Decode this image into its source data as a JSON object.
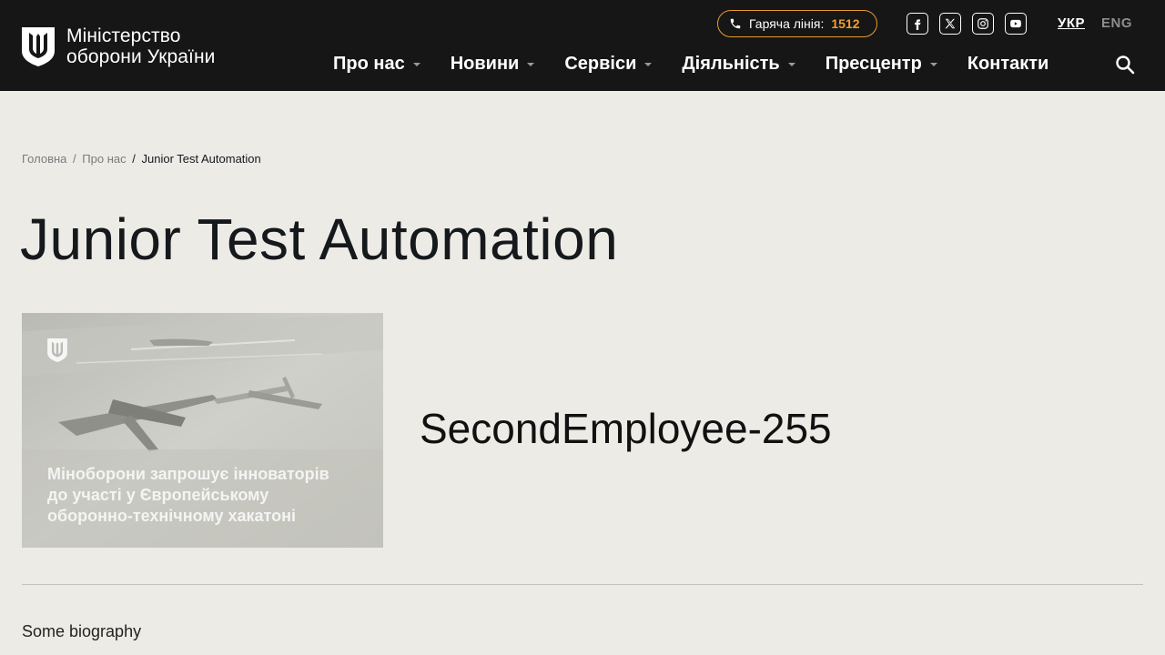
{
  "header": {
    "logo_line1": "Міністерство",
    "logo_line2": "оборони України",
    "hotline_label": "Гаряча лінія:",
    "hotline_number": "1512",
    "socials": [
      "facebook-icon",
      "x-twitter-icon",
      "instagram-icon",
      "youtube-icon"
    ],
    "lang_ukr": "УКР",
    "lang_eng": "ENG",
    "accent_color": "#e89a2e"
  },
  "nav": {
    "items": [
      {
        "label": "Про нас",
        "has_caret": true
      },
      {
        "label": "Новини",
        "has_caret": true
      },
      {
        "label": "Сервіси",
        "has_caret": true
      },
      {
        "label": "Діяльність",
        "has_caret": true
      },
      {
        "label": "Пресцентр",
        "has_caret": true
      },
      {
        "label": "Контакти",
        "has_caret": false
      }
    ]
  },
  "breadcrumb": {
    "home": "Головна",
    "sep1": "/",
    "section": "Про нас",
    "sep2": "/",
    "current": "Junior Test Automation"
  },
  "page": {
    "title": "Junior Test Automation",
    "employee_name": "SecondEmployee-255",
    "photo_caption_line1": "Міноборони запрошує інноваторів",
    "photo_caption_line2": "до участі у Європейському",
    "photo_caption_line3": "оборонно-технічному хакатоні",
    "bio": "Some biography"
  }
}
